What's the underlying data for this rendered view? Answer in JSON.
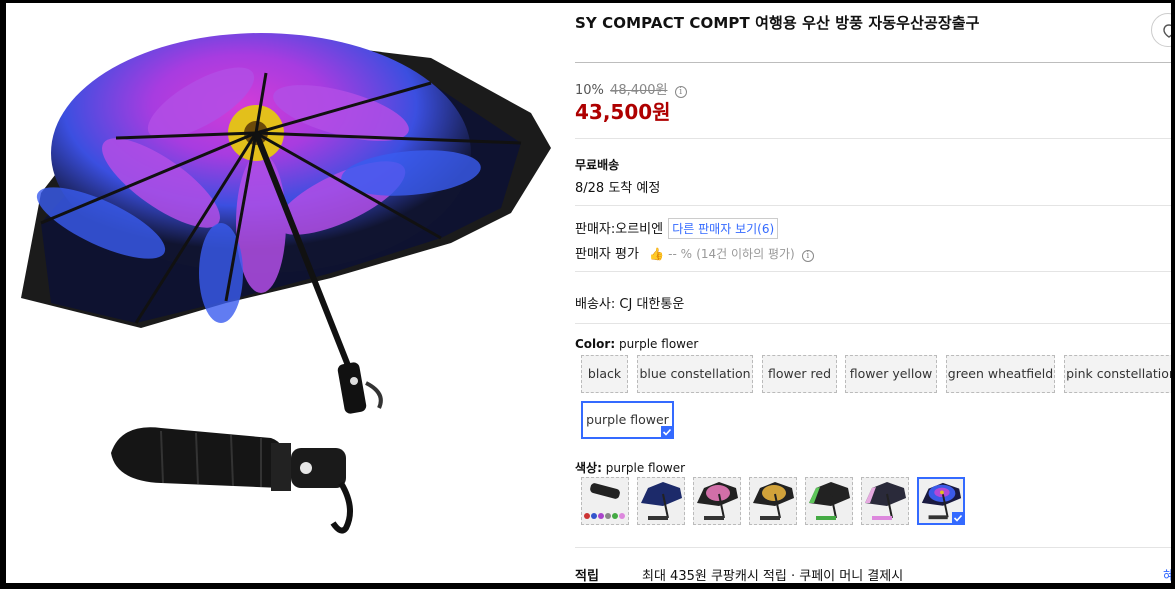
{
  "product": {
    "title": "SY COMPACT COMPT 여행용 우산 방풍 자동우산공장출구"
  },
  "price": {
    "discount_rate": "10%",
    "original_price": "48,400원",
    "sale_price": "43,500원"
  },
  "shipping": {
    "label": "무료배송",
    "arrival": "8/28 도착 예정"
  },
  "seller": {
    "label": "판매자:",
    "name": "오르비엔",
    "other_sellers": "다른 판매자 보기(6)",
    "rating_label": "판매자 평가",
    "rating_value": "-- %",
    "rating_note": "(14건 이하의 평가)"
  },
  "carrier": {
    "label": "배송사:",
    "name": "CJ 대한통운"
  },
  "color_option": {
    "label": "Color:",
    "selected": "purple flower",
    "options": [
      "black",
      "blue constellation",
      "flower red",
      "flower yellow",
      "green wheatfield",
      "pink constellation",
      "purple flower"
    ]
  },
  "swatch_option": {
    "label": "색상:",
    "selected": "purple flower",
    "thumbs": [
      "black",
      "blue constellation",
      "flower red",
      "flower yellow",
      "green wheatfield",
      "pink constellation",
      "purple flower"
    ]
  },
  "reward": {
    "label": "적립",
    "text": "최대 435원 쿠팡캐시 적립 · 쿠페이 머니 결제시",
    "link": "혜"
  },
  "icons": {
    "share": "share-icon",
    "info": "info-icon",
    "thumbs_up": "thumbs-up-icon",
    "check": "check-icon"
  },
  "colors": {
    "price_red": "#ae0000",
    "accent_blue": "#346aff"
  }
}
